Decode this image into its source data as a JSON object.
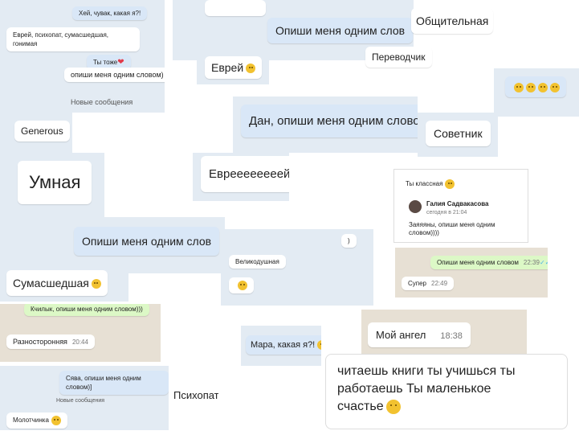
{
  "tiles": {
    "t1": {
      "out_msg": "Хей, чувак, какая я?!",
      "in_msg": "Еврей, психопат, сумасшедшая, гонимая",
      "out2": "Ты тоже",
      "partial": "опиши меня одним словом)",
      "divider": "Новые сообщения"
    },
    "t2": {
      "msg": "Опиши меня одним слов"
    },
    "t3": {
      "msg": "Общительная"
    },
    "t4": {
      "msg": "Переводчик"
    },
    "t5": {
      "msg": "Еврей"
    },
    "t6": {
      "msg": "Generous"
    },
    "t7": {
      "msg": "Дан, опиши меня одним словом"
    },
    "t8": {
      "msg": "Советник"
    },
    "t9": {
      "msg": "Умная"
    },
    "t10": {
      "msg": "Евреееееееей"
    },
    "t11": {
      "top": "Ты классная",
      "name": "Галия Садвакасова",
      "date": "сегодня в 21:04",
      "quote": "Заяяяны, опиши меня одним словом))))"
    },
    "t12": {
      "msg": "Опиши меня одним слов"
    },
    "t13": {
      "msg": "Великодушная"
    },
    "t14": {
      "msg": "Опиши меня одним словом",
      "time1": "22:39",
      "reply": "Супер",
      "time2": "22:49"
    },
    "t15": {
      "msg": "Сумасшедшая"
    },
    "t16": {
      "msg": "Разносторонняя",
      "time": "20:44",
      "partial": "Кчилык, опиши меня одним словом)))"
    },
    "t17": {
      "msg": "Мара, какая я?!"
    },
    "t18": {
      "msg": "Мой ангел",
      "time": "18:38"
    },
    "t19": {
      "line1": "читаешь книги ты учишься ты",
      "line2": "работаешь Ты маленькое",
      "line3": "счастье"
    },
    "t20": {
      "msg": "Сява, опиши меня одним словом)]",
      "divider": "Новые сообщения",
      "reply": "Молотчинка"
    },
    "t21": {
      "msg": "Психопат"
    },
    "t22": {
      "msg": ")"
    }
  },
  "emoji_row": "😂😂😂😂",
  "colors": {
    "chat_bg": "#e3ebf3",
    "out_bubble": "#d9e7f7",
    "wa_bg": "#e7e0d4",
    "wa_out": "#dcf8c6"
  }
}
